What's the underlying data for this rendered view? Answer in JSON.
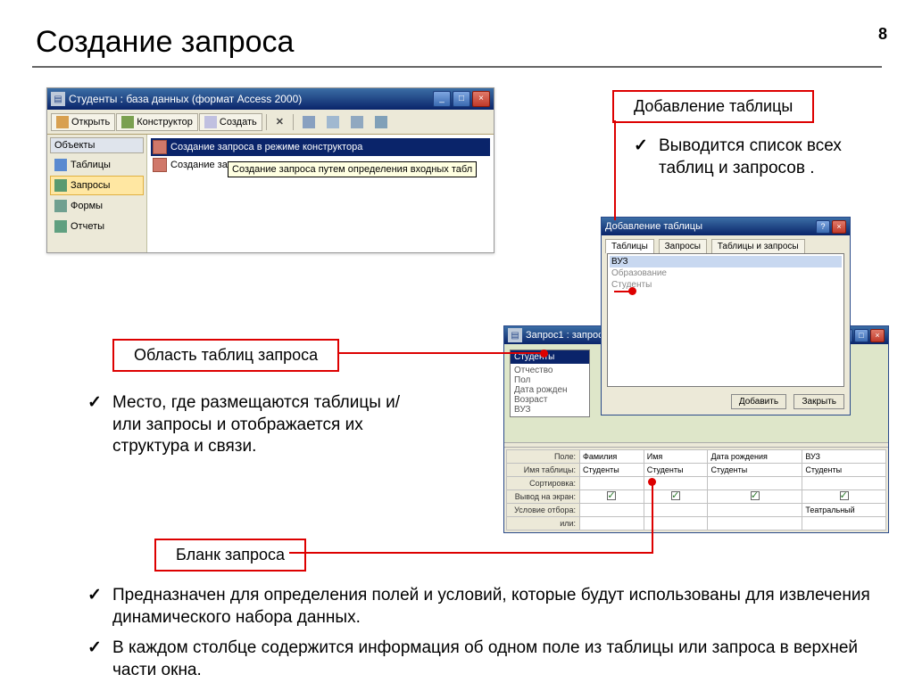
{
  "slide": {
    "title": "Создание запроса",
    "number": "8"
  },
  "db_window": {
    "title": "Студенты : база данных (формат Access 2000)",
    "toolbar": {
      "open": "Открыть",
      "design": "Конструктор",
      "create": "Создать"
    },
    "nav_header": "Объекты",
    "nav": [
      "Таблицы",
      "Запросы",
      "Формы",
      "Отчеты"
    ],
    "list": {
      "item1": "Создание запроса в режиме конструктора",
      "item2": "Создание запроса с помощью мастера"
    },
    "tooltip": "Создание запроса путем определения входных табл"
  },
  "callouts": {
    "add_table": "Добавление таблицы",
    "tables_area": "Область таблиц запроса",
    "query_form": "Бланк запроса"
  },
  "bullets": {
    "add_table": "Выводится список всех таблиц и запросов .",
    "tables_area": "Место, где размещаются таблицы и/или запросы и отображается их структура и связи.",
    "form1": "Предназначен для определения полей и условий, которые будут использованы для извлечения динамического набора данных.",
    "form2": "В каждом столбце содержится информация об одном поле из таблицы или запроса в верхней части окна."
  },
  "add_table_dlg": {
    "title": "Добавление таблицы",
    "tabs": [
      "Таблицы",
      "Запросы",
      "Таблицы и запросы"
    ],
    "items": [
      "ВУЗ",
      "Образование",
      "Студенты"
    ],
    "btn_add": "Добавить",
    "btn_close": "Закрыть"
  },
  "qd": {
    "title": "Запрос1 : запрос на выборку",
    "table_name": "Студенты",
    "fields": [
      "Отчество",
      "Пол",
      "Дата рожден",
      "Возраст",
      "ВУЗ"
    ],
    "row_labels": {
      "field": "Поле:",
      "table": "Имя таблицы:",
      "sort": "Сортировка:",
      "show": "Вывод на экран:",
      "criteria": "Условие отбора:",
      "or": "или:"
    },
    "cols": [
      {
        "field": "Фамилия",
        "table": "Студенты",
        "show": true,
        "criteria": ""
      },
      {
        "field": "Имя",
        "table": "Студенты",
        "show": true,
        "criteria": ""
      },
      {
        "field": "Дата рождения",
        "table": "Студенты",
        "show": true,
        "criteria": ""
      },
      {
        "field": "ВУЗ",
        "table": "Студенты",
        "show": true,
        "criteria": "Театральный"
      }
    ]
  }
}
